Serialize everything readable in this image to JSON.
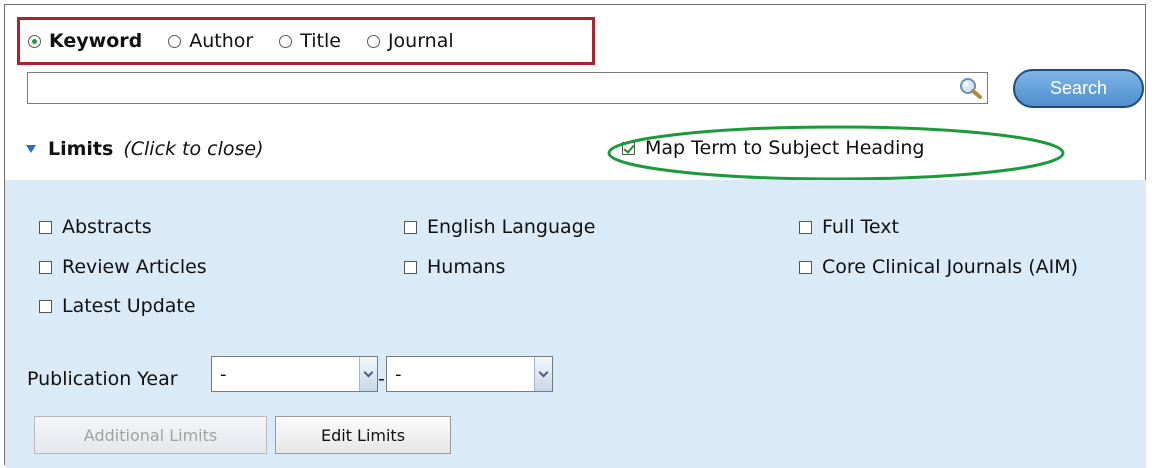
{
  "search_types": [
    {
      "label": "Keyword",
      "selected": true
    },
    {
      "label": "Author",
      "selected": false
    },
    {
      "label": "Title",
      "selected": false
    },
    {
      "label": "Journal",
      "selected": false
    }
  ],
  "search": {
    "value": "",
    "placeholder": "",
    "button_label": "Search"
  },
  "limits": {
    "title": "Limits",
    "hint": "(Click to close)",
    "map_term_label": "Map Term to Subject Heading",
    "map_term_checked": true
  },
  "options": [
    {
      "label": "Abstracts",
      "checked": false
    },
    {
      "label": "English Language",
      "checked": false
    },
    {
      "label": "Full Text",
      "checked": false
    },
    {
      "label": "Review Articles",
      "checked": false
    },
    {
      "label": "Humans",
      "checked": false
    },
    {
      "label": "Core Clinical Journals (AIM)",
      "checked": false
    },
    {
      "label": "Latest Update",
      "checked": false
    }
  ],
  "publication_year": {
    "label": "Publication Year",
    "from": "-",
    "separator": "-",
    "to": "-"
  },
  "buttons": {
    "additional_limits": "Additional Limits",
    "edit_limits": "Edit Limits"
  },
  "colors": {
    "highlight_box": "#b0212b",
    "highlight_ellipse": "#1a9a3a",
    "panel_bg": "#daeaf7",
    "search_button": "#5f9dd6"
  }
}
